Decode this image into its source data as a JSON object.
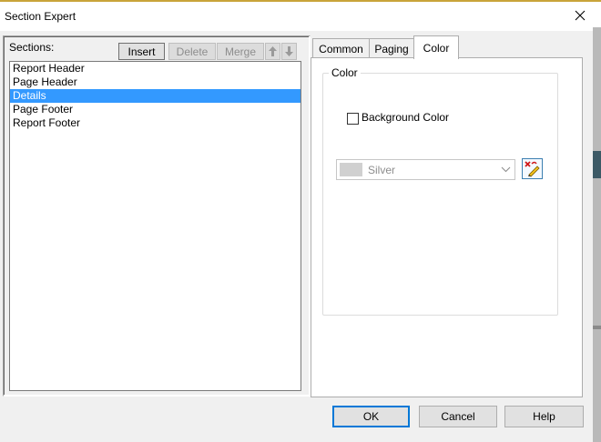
{
  "window": {
    "title": "Section Expert"
  },
  "sections": {
    "label": "Sections:",
    "buttons": {
      "insert": "Insert",
      "delete": "Delete",
      "merge": "Merge"
    },
    "items": [
      {
        "label": "Report Header",
        "selected": false
      },
      {
        "label": "Page Header",
        "selected": false
      },
      {
        "label": "Details",
        "selected": true
      },
      {
        "label": "Page Footer",
        "selected": false
      },
      {
        "label": "Report Footer",
        "selected": false
      }
    ]
  },
  "tabs": [
    {
      "label": "Common",
      "active": false
    },
    {
      "label": "Paging",
      "active": false
    },
    {
      "label": "Color",
      "active": true
    }
  ],
  "color_tab": {
    "group_label": "Color",
    "background_checkbox": {
      "label": "Background Color",
      "checked": false
    },
    "color_select": {
      "value": "Silver",
      "swatch": "#d0d0d0"
    }
  },
  "footer": {
    "ok": "OK",
    "cancel": "Cancel",
    "help": "Help"
  },
  "colors": {
    "selection": "#3399ff",
    "default_button_border": "#0078d7"
  }
}
